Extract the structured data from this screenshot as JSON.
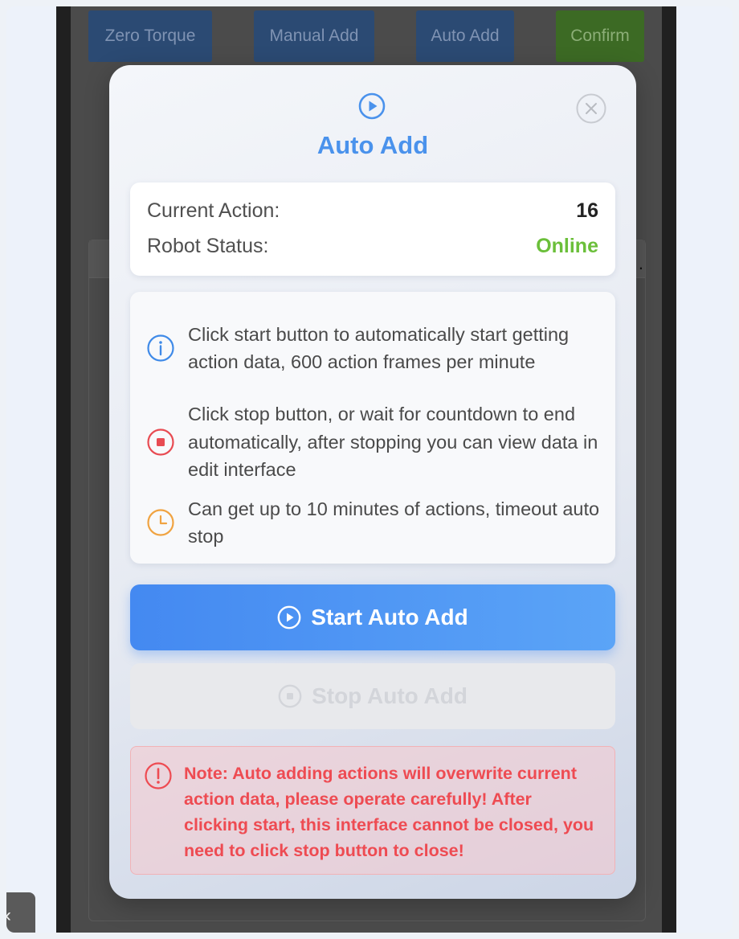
{
  "toolbar": {
    "zero_torque": "Zero Torque",
    "manual_add": "Manual Add",
    "auto_add": "Auto Add",
    "confirm": "Confirm"
  },
  "side_tab": {
    "glyph": "‹"
  },
  "modal": {
    "title": "Auto Add",
    "title_icon": "play-circle-icon",
    "close_icon": "close-circle-icon",
    "status": {
      "current_action_label": "Current Action:",
      "current_action_value": "16",
      "robot_status_label": "Robot Status:",
      "robot_status_value": "Online"
    },
    "info": [
      {
        "icon": "info-icon",
        "text": "Click start button to automatically start getting action data, 600 action frames per minute"
      },
      {
        "icon": "stop-icon",
        "text": "Click stop button, or wait for countdown to end automatically, after stopping you can view data in edit interface"
      },
      {
        "icon": "clock-icon",
        "text": "Can get up to 10 minutes of actions, timeout auto stop"
      }
    ],
    "start_button": "Start Auto Add",
    "stop_button": "Stop Auto Add",
    "warning": "Note: Auto adding actions will overwrite current action data, please operate carefully! After clicking start, this interface cannot be closed, you need to click stop button to close!"
  },
  "colors": {
    "accent_blue": "#4a92ec",
    "online_green": "#6bbf3a",
    "warning_red": "#ee4b52"
  }
}
